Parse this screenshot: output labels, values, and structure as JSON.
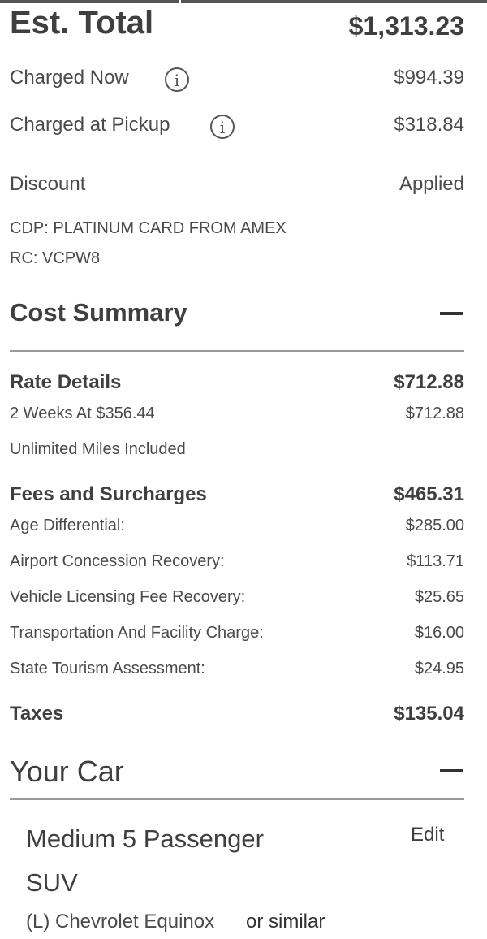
{
  "summary": {
    "est_total_label": "Est. Total",
    "est_total_value": "$1,313.23",
    "charged_now_label": "Charged Now",
    "charged_now_value": "$994.39",
    "charged_pickup_label": "Charged at Pickup",
    "charged_pickup_value": "$318.84",
    "info_glyph": "i",
    "discount_label": "Discount",
    "discount_value": "Applied",
    "cdp_line": "CDP: PLATINUM CARD FROM AMEX",
    "rc_line": "RC: VCPW8"
  },
  "cost_summary": {
    "title": "Cost Summary",
    "rate": {
      "label": "Rate Details",
      "total": "$712.88",
      "line1_label": "2 Weeks At $356.44",
      "line1_value": "$712.88",
      "line2_label": "Unlimited Miles Included"
    },
    "fees": {
      "label": "Fees and Surcharges",
      "total": "$465.31",
      "items": [
        {
          "label": "Age Differential:",
          "value": "$285.00"
        },
        {
          "label": "Airport Concession Recovery:",
          "value": "$113.71"
        },
        {
          "label": "Vehicle Licensing Fee Recovery:",
          "value": "$25.65"
        },
        {
          "label": "Transportation And Facility Charge:",
          "value": "$16.00"
        },
        {
          "label": "State Tourism Assessment:",
          "value": "$24.95"
        }
      ]
    },
    "taxes": {
      "label": "Taxes",
      "total": "$135.04"
    }
  },
  "your_car": {
    "title": "Your Car",
    "edit_label": "Edit",
    "car_class_line1": "Medium 5 Passenger",
    "car_class_line2": "SUV",
    "car_model": "(L) Chevrolet Equinox",
    "or_similar": "or similar"
  },
  "icons": {
    "info": "info-icon",
    "collapse": "minus-icon"
  }
}
